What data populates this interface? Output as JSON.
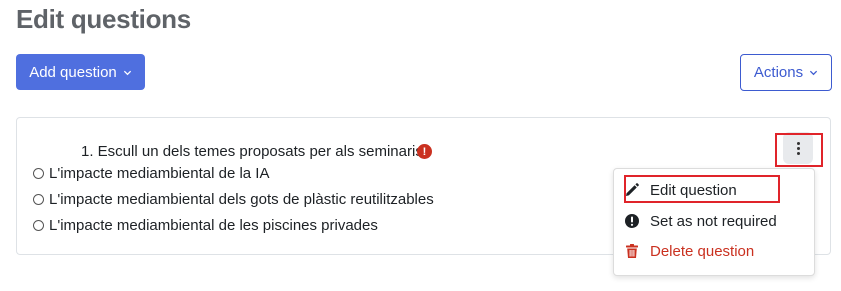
{
  "header": {
    "title": "Edit questions"
  },
  "toolbar": {
    "add_question_label": "Add question",
    "actions_label": "Actions"
  },
  "question": {
    "title": "1. Escull un dels temes proposats per als seminaris",
    "required_icon": "exclamation-icon",
    "options": [
      "L'impacte mediambiental de la IA",
      "L'impacte mediambiental dels gots de plàstic reutilitzables",
      "L'impacte mediambiental de les piscines privades"
    ]
  },
  "menu": {
    "items": [
      {
        "label": "Edit question",
        "icon": "pencil-icon"
      },
      {
        "label": "Set as not required",
        "icon": "exclamation-icon"
      },
      {
        "label": "Delete question",
        "icon": "trash-icon"
      }
    ]
  },
  "colors": {
    "primary": "#4f6fdf",
    "outline": "#3d5bd0",
    "danger": "#ca3120",
    "highlight": "#e0242a"
  }
}
